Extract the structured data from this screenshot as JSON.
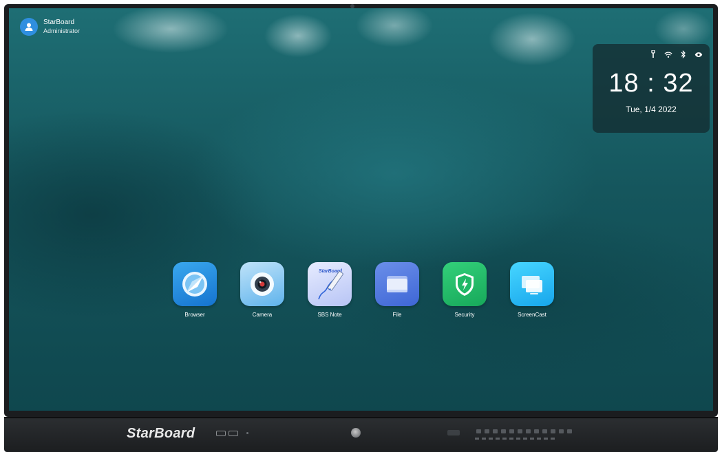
{
  "user": {
    "name": "StarBoard",
    "role": "Administrator"
  },
  "clock": {
    "time": "18 : 32",
    "date": "Tue, 1/4 2022",
    "status_icons": [
      "usb-key-icon",
      "wifi-icon",
      "bluetooth-icon",
      "eye-icon"
    ]
  },
  "apps": [
    {
      "label": "Browser",
      "icon": "browser-icon"
    },
    {
      "label": "Camera",
      "icon": "camera-icon"
    },
    {
      "label": "SBS Note",
      "icon": "sbs-note-icon",
      "badge": "StarBoard"
    },
    {
      "label": "File",
      "icon": "file-icon"
    },
    {
      "label": "Security",
      "icon": "security-icon"
    },
    {
      "label": "ScreenCast",
      "icon": "screencast-icon"
    }
  ],
  "device": {
    "brand": "StarBoard"
  },
  "colors": {
    "wallpaper": "#15565d",
    "clock_panel": "#14282c",
    "avatar": "#2f8fe0"
  }
}
